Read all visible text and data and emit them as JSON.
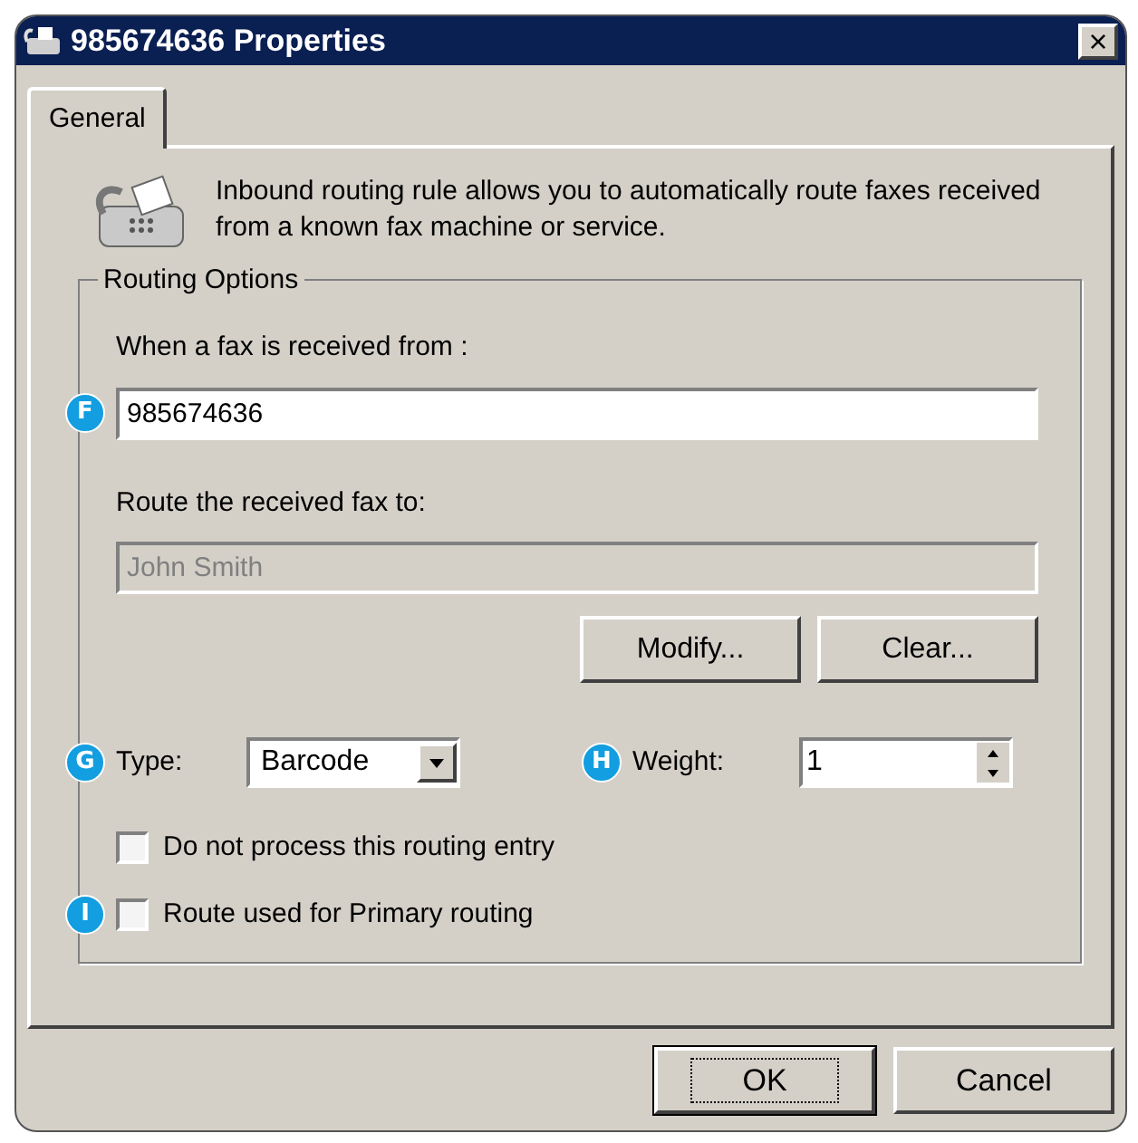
{
  "window": {
    "title": "985674636 Properties",
    "close": "×"
  },
  "tabs": [
    {
      "label": "General",
      "selected": true
    }
  ],
  "intro": "Inbound routing rule allows you to automatically route faxes received from a known fax machine or service.",
  "routing_options": {
    "title": "Routing Options",
    "from_label": "When a fax is received from :",
    "from_field": {
      "value": "985674636",
      "disabled": false,
      "callout": "F"
    },
    "route_label": "Route the received fax to:",
    "route_field": {
      "value": "John Smith",
      "disabled": true
    },
    "buttons": [
      "Modify...",
      "Clear..."
    ],
    "type": {
      "label": "Type:",
      "value": "Barcode",
      "callout": "G"
    },
    "weight": {
      "label": "Weight:",
      "value": "1",
      "callout": "H"
    },
    "checkboxes": [
      {
        "label": "Do not process this routing entry",
        "checked": false
      },
      {
        "label": "Route used for Primary routing",
        "checked": false,
        "callout": "I"
      }
    ]
  },
  "footer_buttons": [
    {
      "label": "OK",
      "default": true
    },
    {
      "label": "Cancel",
      "default": false
    }
  ]
}
